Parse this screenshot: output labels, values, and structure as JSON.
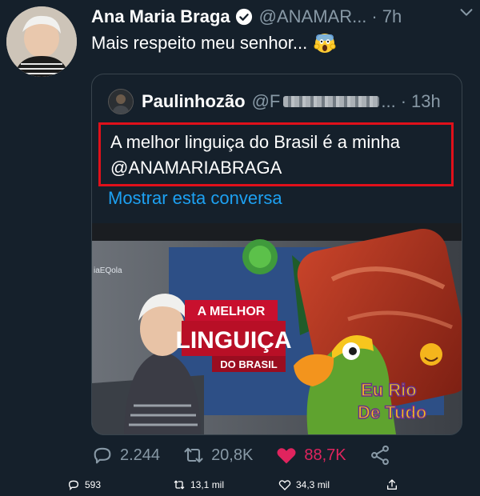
{
  "tweet": {
    "author_name": "Ana Maria Braga",
    "author_handle": "@ANAMAR...",
    "separator": "·",
    "time": "7h",
    "text": "Mais respeito meu senhor...",
    "emoji": "face-screaming-in-fear"
  },
  "quote": {
    "author_name": "Paulinhozão",
    "author_handle_visible": "@F",
    "handle_ellipsis": "...",
    "separator": "·",
    "time": "13h",
    "text_line1": "A melhor linguiça do Brasil é a minha",
    "text_line2": "@ANAMARIABRAGA",
    "show_thread": "Mostrar esta conversa",
    "media": {
      "sign_line1": "A MELHOR",
      "sign_line2": "LINGUIÇA",
      "sign_line3": "DO BRASIL",
      "corner_text": "iaEQola",
      "watermark_line1": "Eu Rio",
      "watermark_line2": "De Tudo"
    }
  },
  "actions": {
    "replies": "2.244",
    "retweets": "20,8K",
    "likes": "88,7K"
  },
  "bottom_bar": {
    "replies": "593",
    "retweets": "13,1 mil",
    "likes": "34,3 mil"
  },
  "colors": {
    "background": "#15202b",
    "secondary_text": "#8899a6",
    "link": "#1da1f2",
    "like": "#e0245e",
    "highlight_border": "#e0101a",
    "verified": "#1da1f2"
  }
}
